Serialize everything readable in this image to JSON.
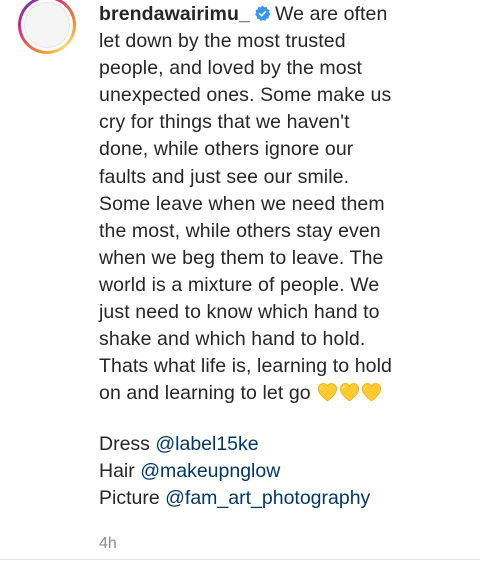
{
  "comment": {
    "username": "brendawairimu_",
    "verified_icon": "verified-badge-icon",
    "caption_first_line": "We are often",
    "caption_lines": [
      "let down by the most trusted",
      "people, and loved by the most",
      "unexpected ones. Some make us",
      "cry for things that we haven't",
      "done, while others ignore our",
      "faults and just see our smile.",
      "Some leave when we need them",
      "the most, while others stay even",
      "when we beg them to leave. The",
      "world is a mixture of people. We",
      "just need to know which hand to",
      "shake and which hand to hold.",
      "Thats what life is, learning to hold"
    ],
    "caption_last_line": "on and learning to let go",
    "emoji": [
      "yellow-heart-icon",
      "yellow-heart-icon",
      "yellow-heart-icon"
    ],
    "credits": [
      {
        "label": "Dress",
        "mention": "@label15ke"
      },
      {
        "label": "Hair",
        "mention": "@makeupnglow"
      },
      {
        "label": "Picture",
        "mention": "@fam_art_photography"
      }
    ],
    "timestamp": "4h"
  },
  "colors": {
    "text": "#262626",
    "mention": "#00376b",
    "muted": "#8e8e8e",
    "verified": "#3897f0",
    "heart": "#fdcb2f"
  }
}
